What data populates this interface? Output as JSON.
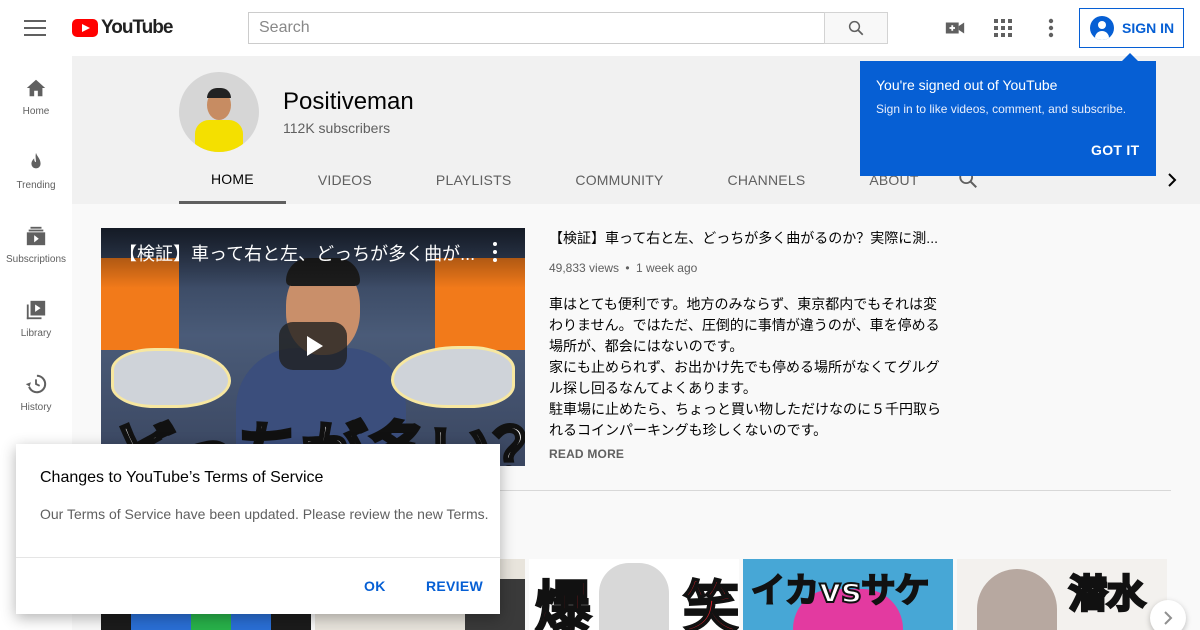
{
  "topbar": {
    "logo_text": "YouTube",
    "search_placeholder": "Search",
    "signin_label": "SIGN IN",
    "icons": [
      "menu-icon",
      "youtube-logo",
      "search-icon",
      "create-video-icon",
      "apps-icon",
      "more-vert-icon",
      "account-icon"
    ]
  },
  "sidebar": {
    "items": [
      {
        "label": "Home",
        "icon": "home-icon"
      },
      {
        "label": "Trending",
        "icon": "flame-icon"
      },
      {
        "label": "Subscriptions",
        "icon": "subscriptions-icon"
      },
      {
        "label": "Library",
        "icon": "library-icon"
      },
      {
        "label": "History",
        "icon": "history-icon"
      }
    ]
  },
  "channel": {
    "name": "Positiveman",
    "subscribers": "112K subscribers",
    "tabs": [
      "HOME",
      "VIDEOS",
      "PLAYLISTS",
      "COMMUNITY",
      "CHANNELS",
      "ABOUT"
    ],
    "active_tab": "HOME"
  },
  "featured_video": {
    "overlay_title": "【検証】車って右と左、どっちが多く曲が...",
    "thumbnail_text": "どっちが多い？",
    "title": "【検証】車って右と左、どっちが多く曲がるのか？実際に測...",
    "views": "49,833 views",
    "separator": "•",
    "age": "1 week ago",
    "description": [
      "車はとても便利です。地方のみならず、東京都内でもそれは変わりません。ではただ、圧倒的に事情が違うのが、車を停める場所が、都会にはないのです。",
      "家にも止められず、お出かけ先でも停める場所がなくてグルグル探し回るなんてよくあります。",
      "駐車場に止めたら、ちょっと買い物しただけなのに５千円取られるコインパーキングも珍しくないのです。"
    ],
    "read_more": "READ MORE"
  },
  "shelf": {
    "thumb_texts": [
      "",
      "",
      "爆笑",
      "イカvsサケ",
      "潜水"
    ]
  },
  "signed_out_popup": {
    "title": "You're signed out of YouTube",
    "subtitle": "Sign in to like videos, comment, and subscribe.",
    "button": "GOT IT"
  },
  "terms_dialog": {
    "title": "Changes to YouTube’s Terms of Service",
    "body": "Our Terms of Service have been updated. Please review the new Terms.",
    "ok": "OK",
    "review": "REVIEW"
  },
  "colors": {
    "brand_red": "#ff0000",
    "accent_blue": "#065fd4",
    "header_bg": "#f1f1f1",
    "page_bg": "#f9f9f9"
  }
}
